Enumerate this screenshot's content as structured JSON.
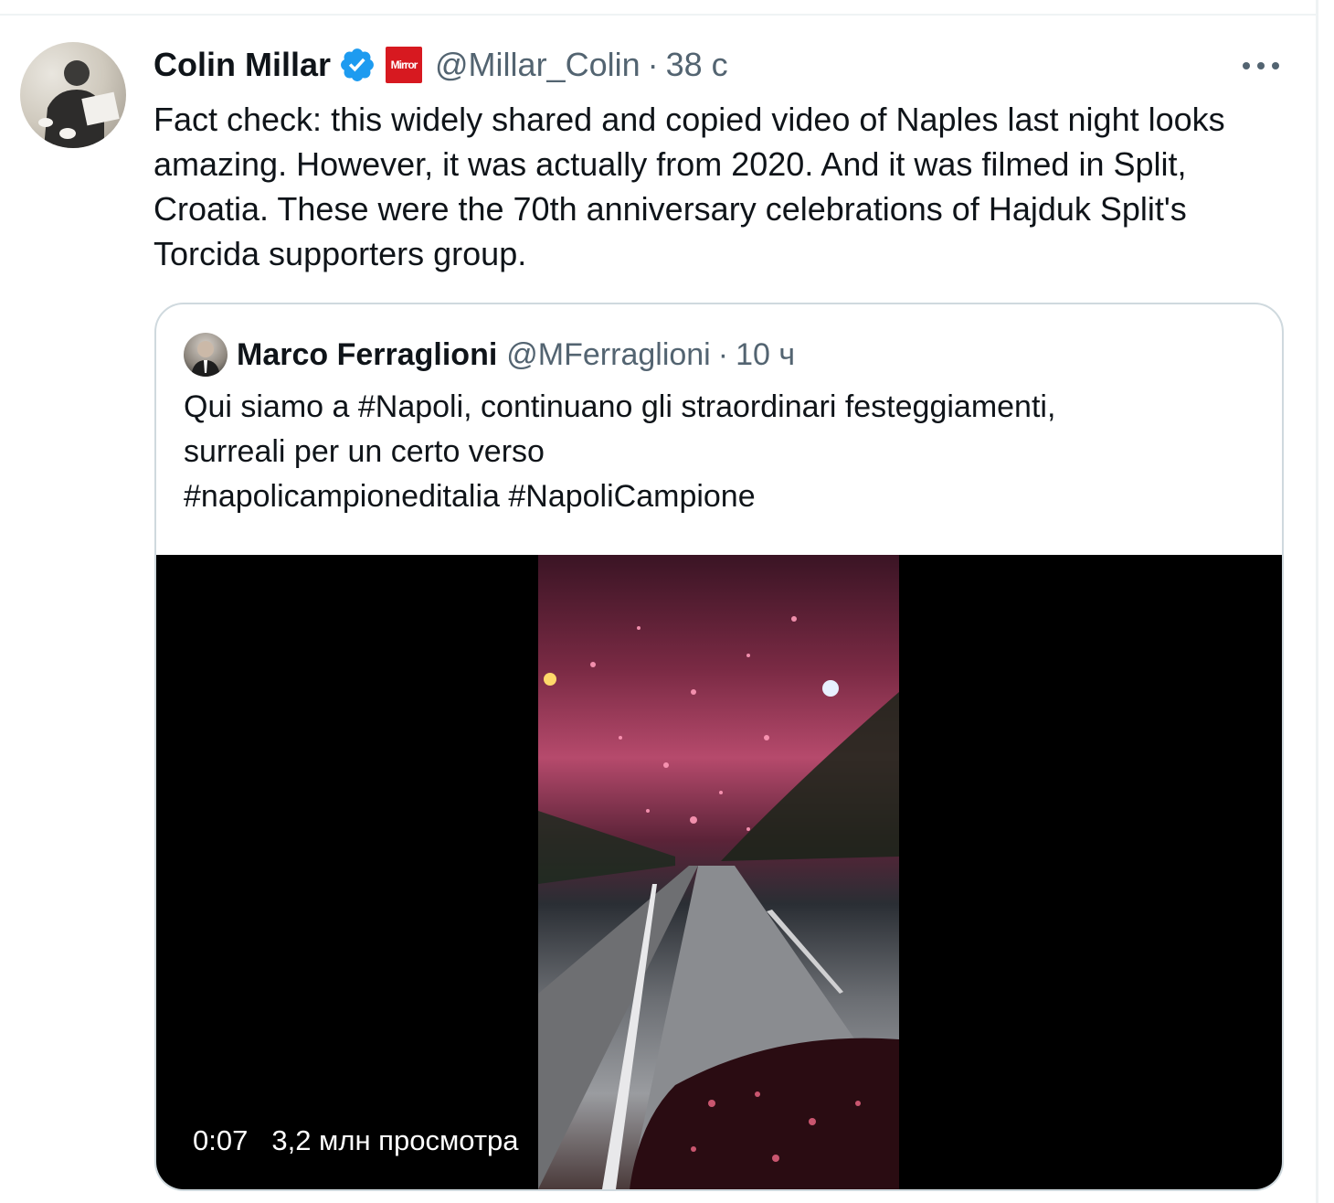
{
  "tweet": {
    "author_name": "Colin Millar",
    "handle": "@Millar_Colin",
    "separator": "·",
    "time": "38 с",
    "org_badge_text": "Mirror",
    "text": "Fact check: this widely shared and copied video of Naples last night looks amazing. However, it was actually from 2020. And it was filmed in Split, Croatia. These were the 70th anniversary celebrations of Hajduk Split's Torcida supporters group."
  },
  "quoted_tweet": {
    "author_name": "Marco Ferraglioni",
    "handle": "@MFerraglioni",
    "separator": "·",
    "time": "10 ч",
    "text_line1": "Qui siamo a #Napoli, continuano gli straordinari festeggiamenti,",
    "text_line2": "surreali per un certo verso",
    "text_line3": "#napolicampioneditalia #NapoliCampione",
    "video": {
      "duration": "0:07",
      "views": "3,2 млн просмотра"
    }
  },
  "colors": {
    "text_primary": "#0f1419",
    "text_secondary": "#536471",
    "verified": "#1d9bf0",
    "border": "#cfd9de",
    "org_badge": "#d71920"
  },
  "icons": [
    "verified-badge-icon",
    "more-options-icon"
  ]
}
